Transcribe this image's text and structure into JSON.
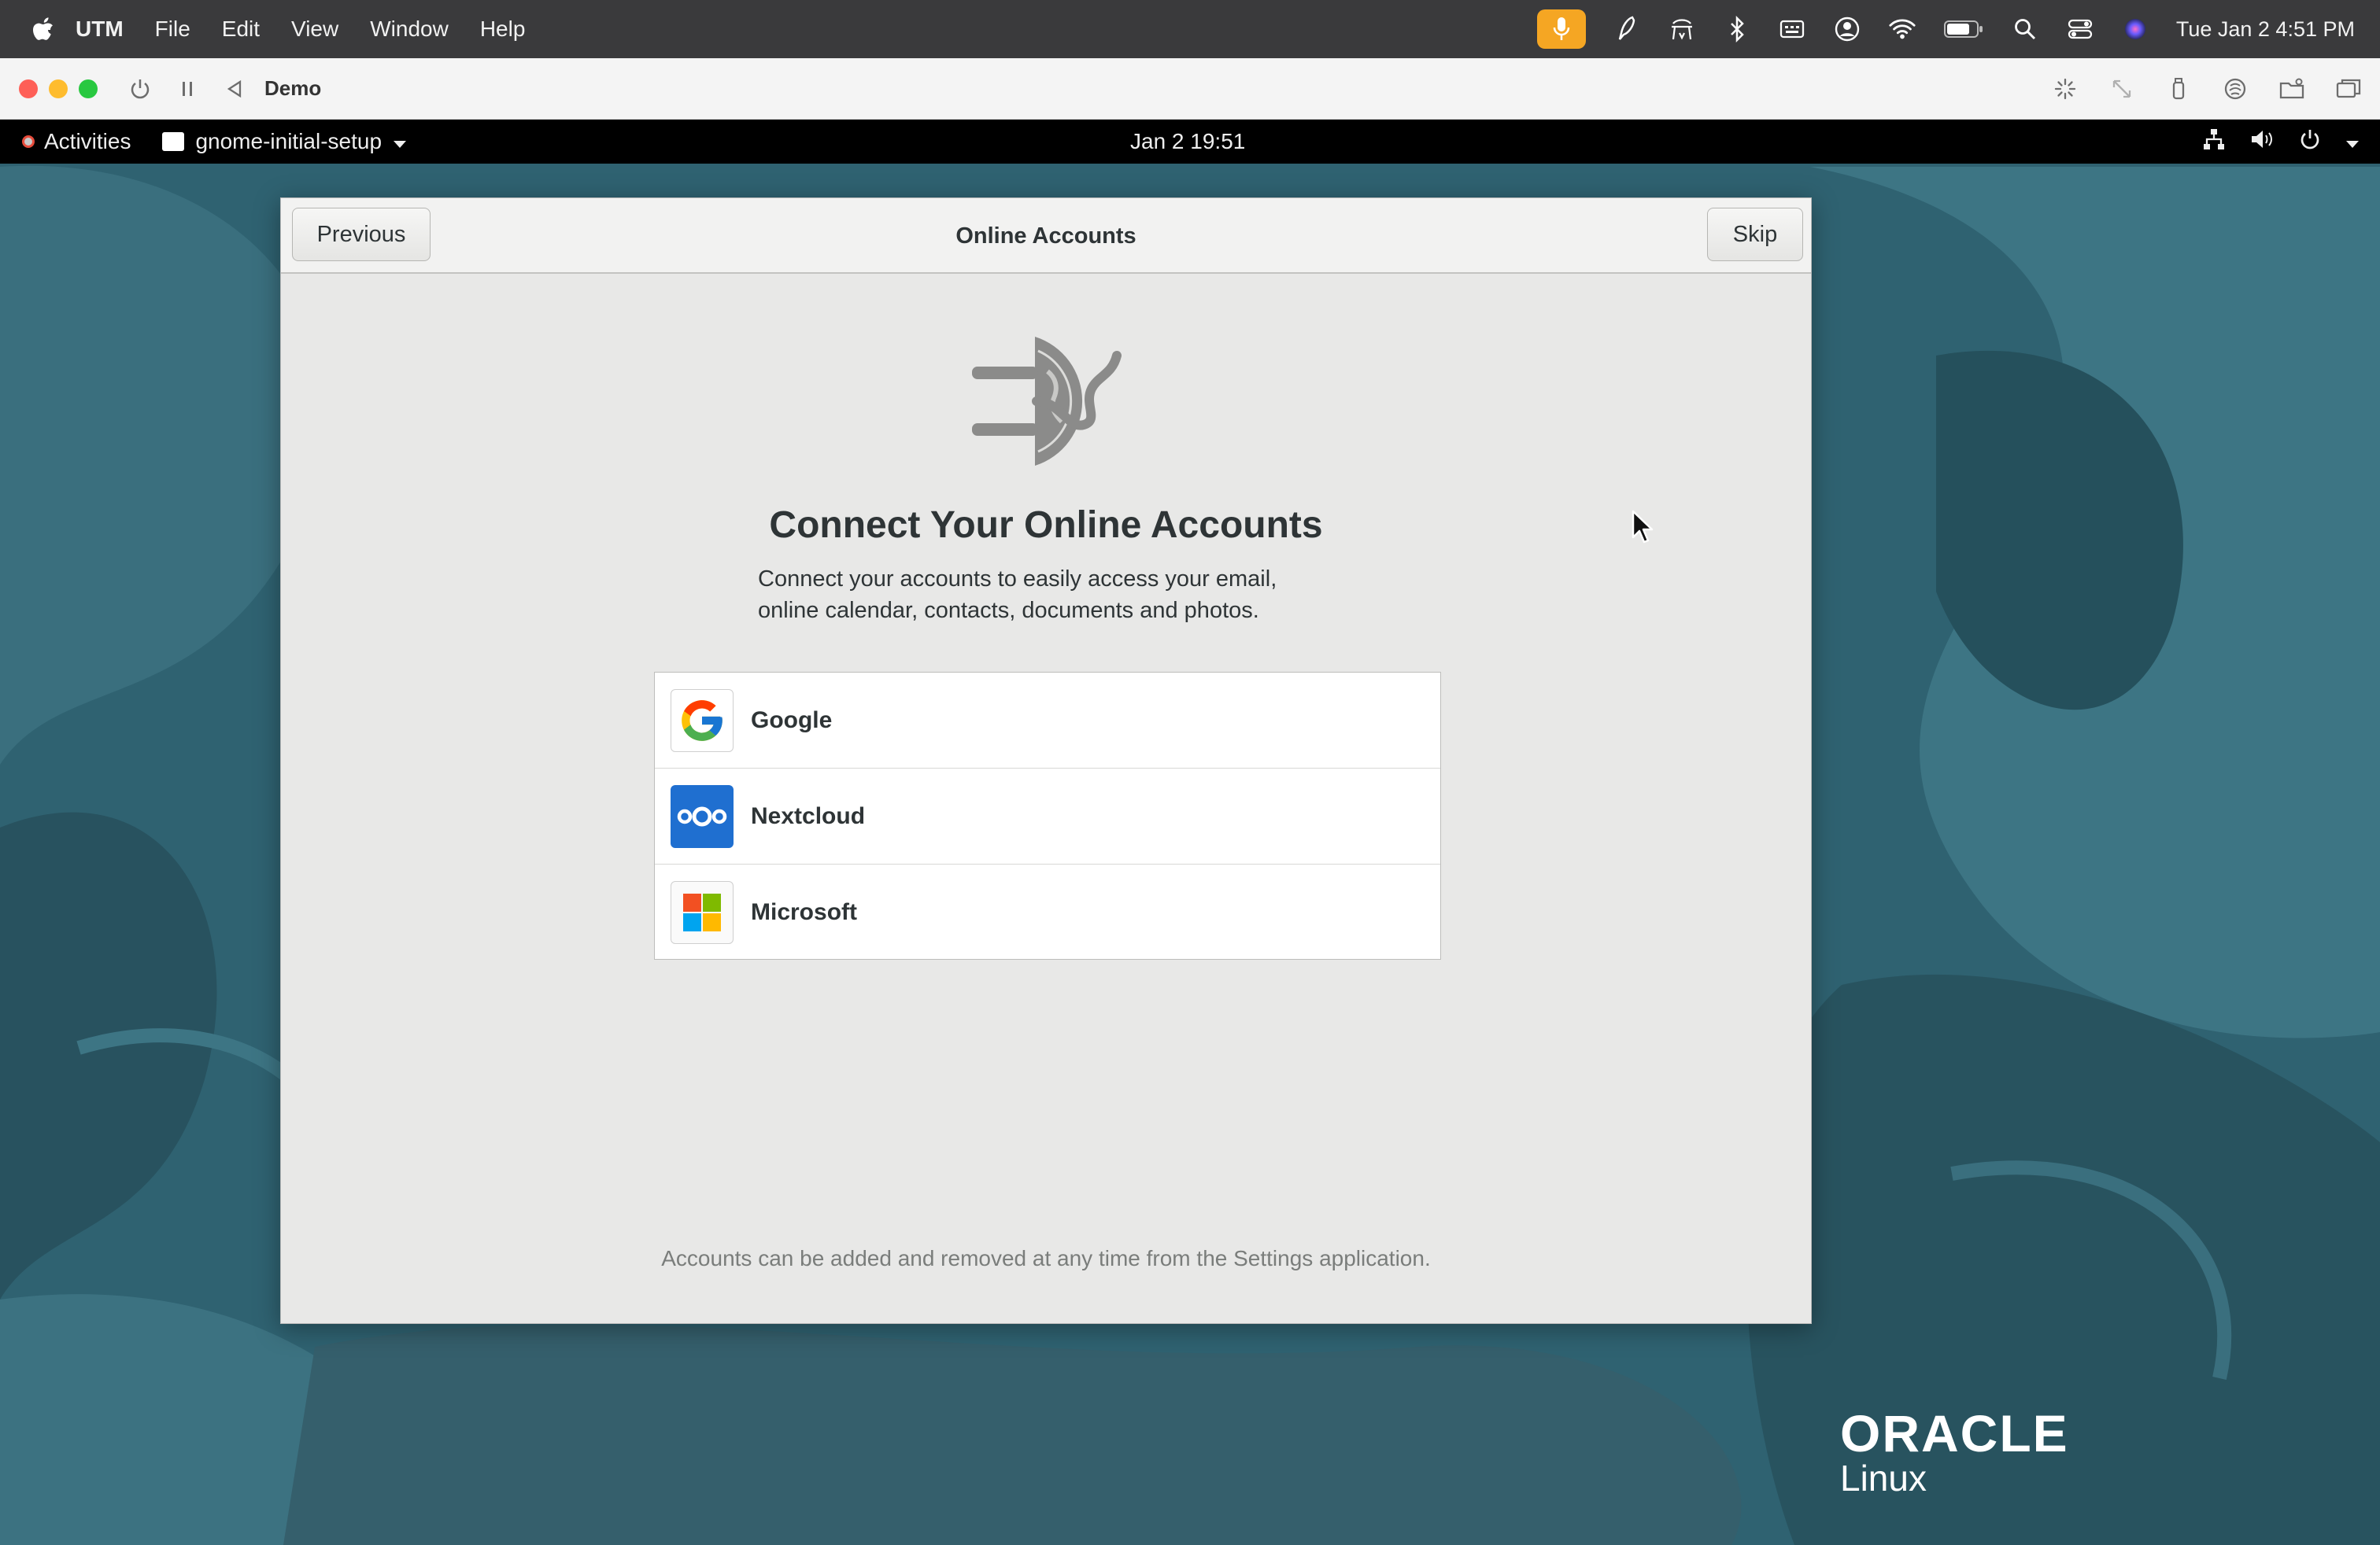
{
  "mac_menubar": {
    "app_name": "UTM",
    "menus": [
      "File",
      "Edit",
      "View",
      "Window",
      "Help"
    ],
    "clock": "Tue Jan 2  4:51 PM"
  },
  "utm_toolbar": {
    "vm_name": "Demo"
  },
  "gnome_topbar": {
    "activities": "Activities",
    "app_menu": "gnome-initial-setup",
    "datetime": "Jan 2  19:51"
  },
  "dialog": {
    "title": "Online Accounts",
    "previous_label": "Previous",
    "skip_label": "Skip",
    "heading": "Connect Your Online Accounts",
    "subtext_line1": "Connect your accounts to easily access your email,",
    "subtext_line2": "online calendar, contacts, documents and photos.",
    "providers": [
      {
        "label": "Google",
        "icon": "google-icon"
      },
      {
        "label": "Nextcloud",
        "icon": "nextcloud-icon"
      },
      {
        "label": "Microsoft",
        "icon": "microsoft-icon"
      }
    ],
    "footer": "Accounts can be added and removed at any time from the Settings application."
  },
  "branding": {
    "oracle": "ORACLE",
    "linux": "Linux"
  },
  "colors": {
    "mac_menubar_bg": "#3a3a3c",
    "mic_accent": "#f5a623",
    "wallpaper_teal": "#2f6271",
    "nextcloud_blue": "#1f6fd0"
  }
}
